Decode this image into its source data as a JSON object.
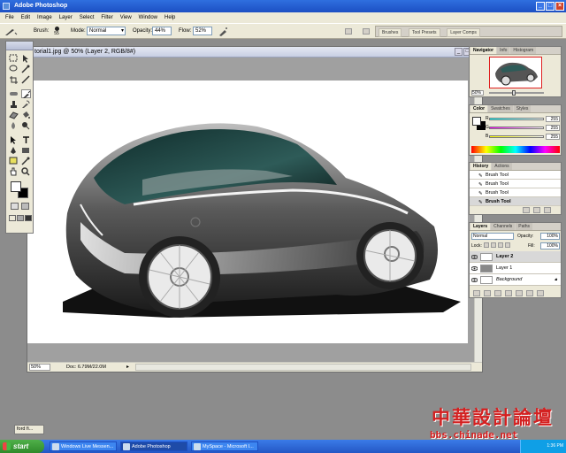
{
  "app": {
    "title": "Adobe Photoshop"
  },
  "menu": [
    "File",
    "Edit",
    "Image",
    "Layer",
    "Select",
    "Filter",
    "View",
    "Window",
    "Help"
  ],
  "options": {
    "brush_label": "Brush:",
    "brush_size": "55",
    "mode_label": "Mode:",
    "mode_value": "Normal",
    "opacity_label": "Opacity:",
    "opacity_value": "44%",
    "flow_label": "Flow:",
    "flow_value": "52%"
  },
  "palette_well": [
    "Brushes",
    "Tool Presets",
    "Layer Comps"
  ],
  "document": {
    "title": "torial1.jpg @ 50% (Layer 2, RGB/8#)",
    "zoom": "50%",
    "doc_info": "Doc: 6.79M/22.0M"
  },
  "navigator": {
    "tabs": [
      "Navigator",
      "Info",
      "Histogram"
    ],
    "zoom": "50%"
  },
  "color_panel": {
    "tabs": [
      "Color",
      "Swatches",
      "Styles"
    ],
    "channels": [
      {
        "label": "R",
        "value": "255",
        "color": "#e03030"
      },
      {
        "label": "G",
        "value": "255",
        "color": "#30b030"
      },
      {
        "label": "B",
        "value": "255",
        "color": "#3050e0"
      }
    ]
  },
  "history": {
    "tabs": [
      "History",
      "Actions"
    ],
    "items": [
      {
        "label": "Brush Tool",
        "active": false
      },
      {
        "label": "Brush Tool",
        "active": false
      },
      {
        "label": "Brush Tool",
        "active": false
      },
      {
        "label": "Brush Tool",
        "active": true
      }
    ]
  },
  "layers_panel": {
    "tabs": [
      "Layers",
      "Channels",
      "Paths"
    ],
    "blend_mode": "Normal",
    "opacity_label": "Opacity:",
    "opacity_value": "100%",
    "lock_label": "Lock:",
    "fill_label": "Fill:",
    "fill_value": "100%",
    "layers": [
      {
        "name": "Layer 2",
        "active": true
      },
      {
        "name": "Layer 1",
        "active": false
      },
      {
        "name": "Background",
        "active": false
      }
    ]
  },
  "mini_palette": {
    "label": "ford fi..."
  },
  "taskbar": {
    "start": "start",
    "items": [
      {
        "label": "Windows Live Messen...",
        "active": false
      },
      {
        "label": "Adobe Photoshop",
        "active": true
      },
      {
        "label": "MySpace - Microsoft I...",
        "active": false
      }
    ],
    "clock": "1:36 PM"
  },
  "watermark": {
    "title": "中華設計論壇",
    "url": "bbs.chinade.net"
  },
  "colors": {
    "title_bar": "#1c4fc3",
    "chrome": "#ece9d8",
    "workspace": "#8c8c8c",
    "watermark": "#d42020"
  }
}
